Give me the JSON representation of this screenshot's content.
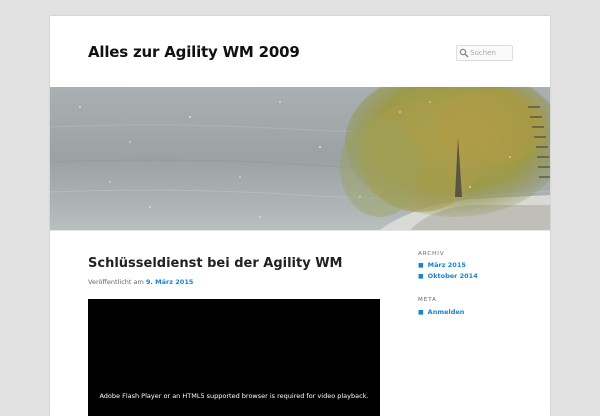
{
  "header": {
    "site_title": "Alles zur Agility WM 2009",
    "search_placeholder": "Suchen"
  },
  "post": {
    "title": "Schlüsseldienst bei der Agility WM",
    "meta_prefix": "Veröffentlicht am",
    "date": "9. März 2015",
    "video_message": "Adobe Flash Player or an HTML5 supported browser is required for video playback."
  },
  "sidebar": {
    "archive_title": "ARCHIV",
    "archive_items": [
      "März 2015",
      "Oktober 2014"
    ],
    "meta_title": "META",
    "meta_items": [
      "Anmelden"
    ]
  },
  "colors": {
    "link": "#1982d1",
    "background": "#e2e2e2",
    "page": "#ffffff"
  }
}
